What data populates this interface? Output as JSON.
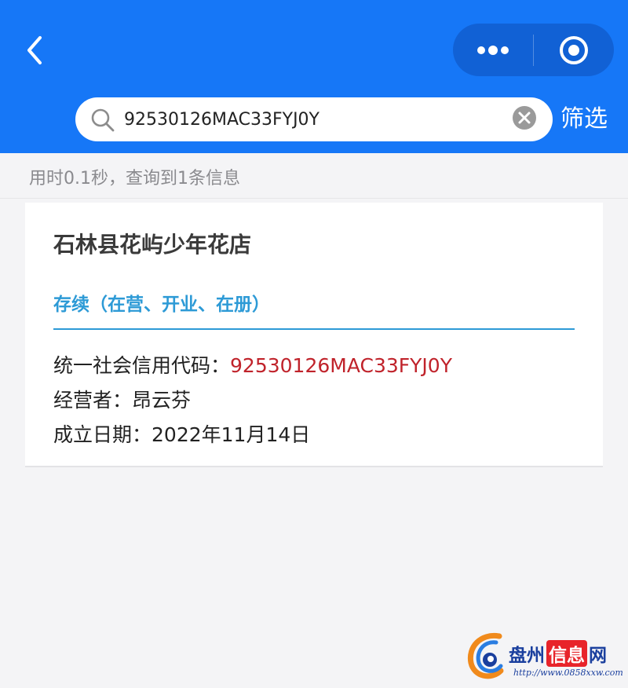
{
  "header": {
    "search_value": "92530126MAC33FYJ0Y",
    "filter_label": "筛选",
    "icons": {
      "back": "chevron-left-icon",
      "more": "more-dots-icon",
      "close_app": "target-circle-icon",
      "search": "search-icon",
      "clear": "clear-x-icon"
    },
    "colors": {
      "bar": "#1677f7"
    }
  },
  "result_info": "用时0.1秒，查询到1条信息",
  "card": {
    "company_name": "石林县花屿少年花店",
    "status": "存续（在营、开业、在册）",
    "rows": [
      {
        "label": "统一社会信用代码：",
        "value": "92530126MAC33FYJ0Y"
      },
      {
        "label": "经营者：",
        "value": "昂云芬"
      },
      {
        "label": "成立日期：",
        "value": "2022年11月14日"
      }
    ],
    "colors": {
      "status": "#2d9ad6",
      "credit_code": "#c0232b"
    }
  },
  "watermark": {
    "title_part1": "盘州",
    "title_part2": "信息",
    "title_part3": "网",
    "url": "http://www.0858xxw.com"
  }
}
